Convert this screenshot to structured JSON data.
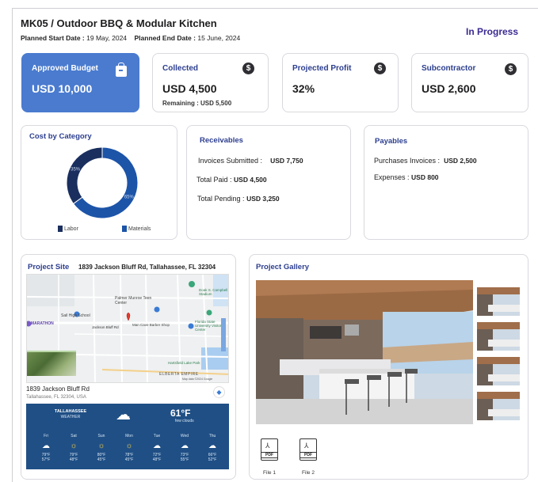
{
  "header": {
    "title": "MK05 / Outdoor BBQ & Modular Kitchen",
    "planned_start_label": "Planned Start Date :",
    "planned_start_value": "19 May, 2024",
    "planned_end_label": "Planned End Date :",
    "planned_end_value": "15 June, 2024",
    "status": "In Progress"
  },
  "kpis": {
    "approved_budget": {
      "title": "Approved Budget",
      "value": "USD 10,000",
      "icon": "budget-bag-icon"
    },
    "collected": {
      "title": "Collected",
      "value": "USD 4,500",
      "sub": "Remaining : USD 5,500",
      "icon": "dollar-icon"
    },
    "projected_profit": {
      "title": "Projected Profit",
      "value": "32%",
      "icon": "dollar-icon"
    },
    "subcontractor": {
      "title": "Subcontractor",
      "value": "USD 2,600",
      "icon": "dollar-icon"
    }
  },
  "cost_by_category": {
    "title": "Cost by Category",
    "legend_labor": "Labor",
    "legend_materials": "Materials",
    "labor_label": "35%",
    "materials_label": "65%",
    "colors": {
      "labor": "#1a2f5e",
      "materials": "#1c54a8"
    }
  },
  "chart_data": {
    "type": "pie",
    "categories": [
      "Labor",
      "Materials"
    ],
    "values": [
      35,
      65
    ],
    "title": "Cost by Category"
  },
  "receivables": {
    "title": "Receivables",
    "invoices_label": "Invoices Submitted :",
    "invoices_value": "USD 7,750",
    "paid_label": "Total Paid :",
    "paid_value": "USD 4,500",
    "pending_label": "Total Pending :",
    "pending_value": "USD 3,250"
  },
  "payables": {
    "title": "Payables",
    "purchases_label": "Purchases Invoices :",
    "purchases_value": "USD 2,500",
    "expenses_label": "Expenses :",
    "expenses_value": "USD 800"
  },
  "project_site": {
    "title": "Project Site",
    "address": "1839 Jackson Bluff Rd, Tallahassee, FL 32304",
    "map_address_line1": "1839 Jackson Bluff Rd",
    "map_address_line2": "Tallahassee, FL 32304, USA",
    "map_labels": {
      "palmer": "Palmer Munroe Teen Center",
      "school": "Sail High School",
      "marathon": "MARATHON",
      "jackson": "Jackson Bluff Rd",
      "barber": "Man Cave Barber Shop",
      "elberta": "ELBERTA EMPIRE",
      "hartsfield": "Hartsfield Lake Park",
      "florida": "Florida State University Visitor Center",
      "dent": "Doak S. Campbell Stadium",
      "mapdata": "Map data ©2024 Google"
    },
    "weather": {
      "city": "TALLAHASSEE",
      "label": "WEATHER",
      "temp": "61°F",
      "condition": "few clouds",
      "days": [
        {
          "d": "Fri",
          "hi": "79°F",
          "lo": "57°F",
          "icon": "cloud-icon"
        },
        {
          "d": "Sat",
          "hi": "79°F",
          "lo": "48°F",
          "icon": "sun-icon"
        },
        {
          "d": "Sun",
          "hi": "80°F",
          "lo": "45°F",
          "icon": "sun-icon"
        },
        {
          "d": "Mon",
          "hi": "78°F",
          "lo": "45°F",
          "icon": "sun-icon"
        },
        {
          "d": "Tue",
          "hi": "72°F",
          "lo": "48°F",
          "icon": "cloud-icon"
        },
        {
          "d": "Wed",
          "hi": "73°F",
          "lo": "55°F",
          "icon": "cloud-icon"
        },
        {
          "d": "Thu",
          "hi": "66°F",
          "lo": "52°F",
          "icon": "cloud-icon"
        }
      ]
    }
  },
  "gallery": {
    "title": "Project Gallery",
    "files": [
      {
        "label": "File 1",
        "tag": "PDF"
      },
      {
        "label": "File 2",
        "tag": "PDF"
      }
    ]
  }
}
